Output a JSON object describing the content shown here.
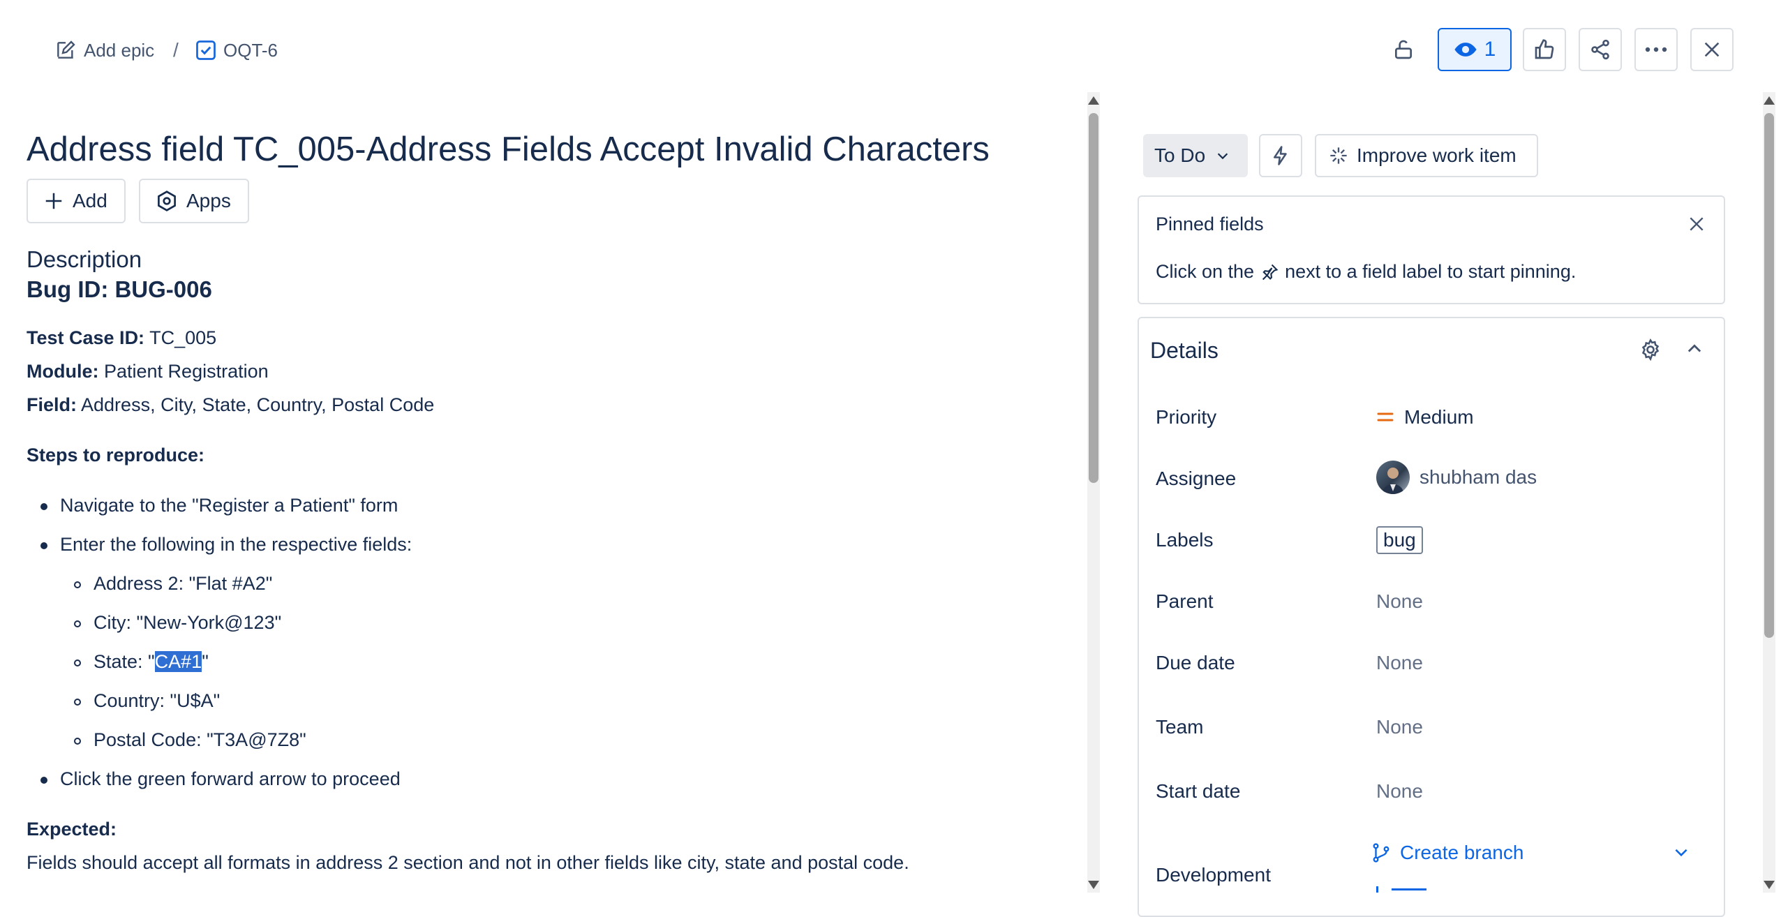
{
  "breadcrumb": {
    "add_epic": "Add epic",
    "separator": "/",
    "issue_key": "OQT-6"
  },
  "toolbar": {
    "watch_count": "1"
  },
  "issue": {
    "title": "Address field TC_005-Address Fields Accept Invalid Characters",
    "add_label": "Add",
    "apps_label": "Apps"
  },
  "description": {
    "heading": "Description",
    "bug_id": "Bug ID: BUG-006",
    "test_case_label": "Test Case ID:",
    "test_case_value": "TC_005",
    "module_label": "Module:",
    "module_value": "Patient Registration",
    "field_label": "Field:",
    "field_value": "Address, City, State, Country, Postal Code",
    "steps_heading": "Steps to reproduce:",
    "step1": "Navigate to the \"Register a Patient\" form",
    "step2": "Enter the following in the respective fields:",
    "sub1": "Address 2: \"Flat #A2\"",
    "sub2": "City: \"New-York@123\"",
    "sub3_prefix": "State: \"",
    "sub3_selected": "CA#1",
    "sub3_suffix": "\"",
    "sub4": "Country: \"U$A\"",
    "sub5": "Postal Code: \"T3A@7Z8\"",
    "step3": "Click the green forward arrow to proceed",
    "expected_heading": "Expected:",
    "expected_text": "Fields should accept all formats in address 2 section and not in other fields like city, state and postal code."
  },
  "status": {
    "label": "To Do",
    "improve_label": "Improve work item"
  },
  "pinned": {
    "title": "Pinned fields",
    "desc_before": "Click on the",
    "desc_after": "next to a field label to start pinning."
  },
  "details": {
    "title": "Details",
    "priority_label": "Priority",
    "priority_value": "Medium",
    "assignee_label": "Assignee",
    "assignee_value": "shubham das",
    "labels_label": "Labels",
    "labels_value": "bug",
    "parent_label": "Parent",
    "parent_value": "None",
    "due_label": "Due date",
    "due_value": "None",
    "team_label": "Team",
    "team_value": "None",
    "start_label": "Start date",
    "start_value": "None",
    "development_label": "Development",
    "create_branch": "Create branch"
  },
  "colors": {
    "accent": "#0c66e4",
    "selection": "#2f6fd3",
    "priority_medium": "#e56910",
    "text": "#172b4d",
    "subtle": "#626f86"
  }
}
